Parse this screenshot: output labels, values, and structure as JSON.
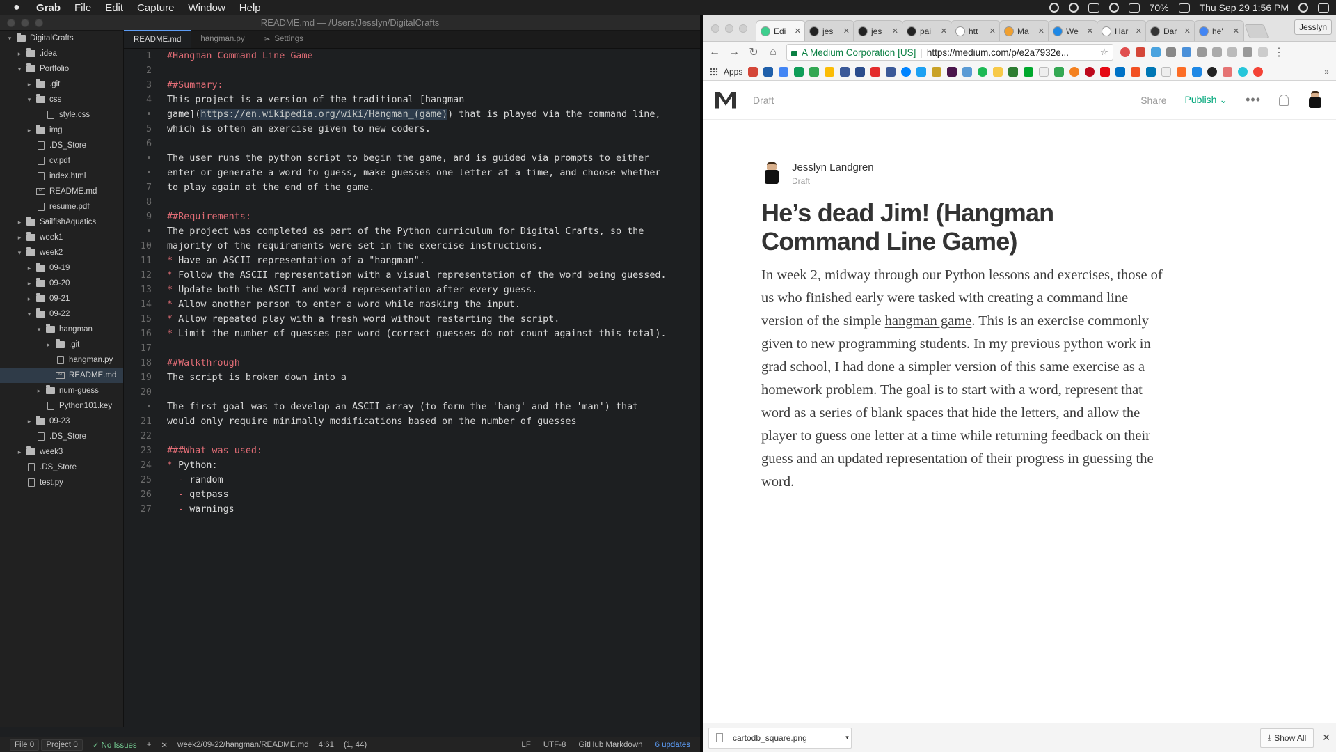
{
  "menubar": {
    "app": "Grab",
    "items": [
      "File",
      "Edit",
      "Capture",
      "Window",
      "Help"
    ],
    "battery": "70%",
    "datetime": "Thu Sep 29  1:56 PM"
  },
  "atom": {
    "window_title": "README.md — /Users/Jesslyn/DigitalCrafts",
    "tabs": [
      "README.md",
      "hangman.py",
      "Settings"
    ],
    "tree": [
      {
        "label": "DigitalCrafts",
        "kind": "folder",
        "indent": 0,
        "arrow": "▾"
      },
      {
        "label": ".idea",
        "kind": "folder",
        "indent": 1,
        "arrow": "▸"
      },
      {
        "label": "Portfolio",
        "kind": "folder",
        "indent": 1,
        "arrow": "▾"
      },
      {
        "label": ".git",
        "kind": "folder",
        "indent": 2,
        "arrow": "▸"
      },
      {
        "label": "css",
        "kind": "folder",
        "indent": 2,
        "arrow": "▾"
      },
      {
        "label": "style.css",
        "kind": "file",
        "indent": 3,
        "arrow": ""
      },
      {
        "label": "img",
        "kind": "folder",
        "indent": 2,
        "arrow": "▸"
      },
      {
        "label": ".DS_Store",
        "kind": "file",
        "indent": 2,
        "arrow": ""
      },
      {
        "label": "cv.pdf",
        "kind": "file",
        "indent": 2,
        "arrow": ""
      },
      {
        "label": "index.html",
        "kind": "file",
        "indent": 2,
        "arrow": ""
      },
      {
        "label": "README.md",
        "kind": "md",
        "indent": 2,
        "arrow": ""
      },
      {
        "label": "resume.pdf",
        "kind": "file",
        "indent": 2,
        "arrow": ""
      },
      {
        "label": "SailfishAquatics",
        "kind": "folder",
        "indent": 1,
        "arrow": "▸"
      },
      {
        "label": "week1",
        "kind": "folder",
        "indent": 1,
        "arrow": "▸"
      },
      {
        "label": "week2",
        "kind": "folder",
        "indent": 1,
        "arrow": "▾"
      },
      {
        "label": "09-19",
        "kind": "folder",
        "indent": 2,
        "arrow": "▸"
      },
      {
        "label": "09-20",
        "kind": "folder",
        "indent": 2,
        "arrow": "▸"
      },
      {
        "label": "09-21",
        "kind": "folder",
        "indent": 2,
        "arrow": "▸"
      },
      {
        "label": "09-22",
        "kind": "folder",
        "indent": 2,
        "arrow": "▾"
      },
      {
        "label": "hangman",
        "kind": "folder",
        "indent": 3,
        "arrow": "▾"
      },
      {
        "label": ".git",
        "kind": "folder",
        "indent": 4,
        "arrow": "▸"
      },
      {
        "label": "hangman.py",
        "kind": "file",
        "indent": 4,
        "arrow": ""
      },
      {
        "label": "README.md",
        "kind": "md",
        "indent": 4,
        "arrow": "",
        "selected": true
      },
      {
        "label": "num-guess",
        "kind": "folder",
        "indent": 3,
        "arrow": "▸"
      },
      {
        "label": "Python101.key",
        "kind": "file",
        "indent": 3,
        "arrow": ""
      },
      {
        "label": "09-23",
        "kind": "folder",
        "indent": 2,
        "arrow": "▸"
      },
      {
        "label": ".DS_Store",
        "kind": "file",
        "indent": 2,
        "arrow": ""
      },
      {
        "label": "week3",
        "kind": "folder",
        "indent": 1,
        "arrow": "▸"
      },
      {
        "label": ".DS_Store",
        "kind": "file",
        "indent": 1,
        "arrow": ""
      },
      {
        "label": "test.py",
        "kind": "file",
        "indent": 1,
        "arrow": ""
      }
    ],
    "gutter": [
      "1",
      "2",
      "3",
      "4",
      "•",
      "5",
      "6",
      "•",
      "•",
      "7",
      "8",
      "9",
      "•",
      "10",
      "11",
      "12",
      "13",
      "14",
      "15",
      "16",
      "17",
      "18",
      "19",
      "20",
      "•",
      "21",
      "22",
      "23",
      "24",
      "25",
      "26",
      "27"
    ],
    "code": [
      {
        "t": "#Hangman Command Line Game",
        "s": "heading"
      },
      {
        "t": "",
        "s": ""
      },
      {
        "t": "##Summary:",
        "s": "heading"
      },
      {
        "t": "This project is a version of the traditional [hangman",
        "s": ""
      },
      {
        "t": "game](https://en.wikipedia.org/wiki/Hangman_(game)) that is played via the command line,",
        "s": "url"
      },
      {
        "t": "which is often an exercise given to new coders.",
        "s": ""
      },
      {
        "t": "",
        "s": ""
      },
      {
        "t": "The user runs the python script to begin the game, and is guided via prompts to either",
        "s": ""
      },
      {
        "t": "enter or generate a word to guess, make guesses one letter at a time, and choose whether",
        "s": ""
      },
      {
        "t": "to play again at the end of the game.",
        "s": ""
      },
      {
        "t": "",
        "s": ""
      },
      {
        "t": "##Requirements:",
        "s": "heading"
      },
      {
        "t": "The project was completed as part of the Python curriculum for Digital Crafts, so the",
        "s": ""
      },
      {
        "t": "majority of the requirements were set in the exercise instructions.",
        "s": ""
      },
      {
        "t": "* Have an ASCII representation of a \"hangman\".",
        "s": "bullet"
      },
      {
        "t": "* Follow the ASCII representation with a visual representation of the word being guessed.",
        "s": "bullet"
      },
      {
        "t": "* Update both the ASCII and word representation after every guess.",
        "s": "bullet"
      },
      {
        "t": "* Allow another person to enter a word while masking the input.",
        "s": "bullet"
      },
      {
        "t": "* Allow repeated play with a fresh word without restarting the script.",
        "s": "bullet"
      },
      {
        "t": "* Limit the number of guesses per word (correct guesses do not count against this total).",
        "s": "bullet"
      },
      {
        "t": "",
        "s": ""
      },
      {
        "t": "##Walkthrough",
        "s": "heading"
      },
      {
        "t": "The script is broken down into a",
        "s": ""
      },
      {
        "t": "",
        "s": ""
      },
      {
        "t": "The first goal was to develop an ASCII array (to form the 'hang' and the 'man') that",
        "s": ""
      },
      {
        "t": "would only require minimally modifications based on the number of guesses",
        "s": ""
      },
      {
        "t": "",
        "s": ""
      },
      {
        "t": "###What was used:",
        "s": "heading"
      },
      {
        "t": "* Python:",
        "s": "bullet"
      },
      {
        "t": "  - random",
        "s": "dash"
      },
      {
        "t": "  - getpass",
        "s": "dash"
      },
      {
        "t": "  - warnings",
        "s": "dash"
      },
      {
        "t": "",
        "s": ""
      }
    ],
    "status": {
      "file": "File 0",
      "project": "Project 0",
      "issues": "✓ No Issues",
      "plus": "+",
      "x": "✕",
      "path": "week2/09-22/hangman/README.md",
      "cursor": "4:61",
      "selection": "(1, 44)",
      "eol": "LF",
      "encoding": "UTF-8",
      "grammar": "GitHub Markdown",
      "updates": "6 updates"
    }
  },
  "chrome": {
    "tabs": [
      "Edi",
      "jes",
      "jes",
      "pai",
      "htt",
      "Ma",
      "We",
      "Har",
      "Dar",
      "he'"
    ],
    "profile": "Jesslyn",
    "secure_label": "A Medium Corporation [US]",
    "url": "https://medium.com/p/e2a7932e...",
    "apps_label": "Apps",
    "accent": "#03a87c"
  },
  "medium": {
    "draft": "Draft",
    "share": "Share",
    "publish": "Publish",
    "author": "Jesslyn Landgren",
    "author_status": "Draft",
    "title": "He’s dead Jim! (Hangman Command Line Game)",
    "body_before": "In week 2, midway through our Python lessons and exercises, those of us who finished early were tasked with creating a command line version of the simple ",
    "body_link": "hangman game",
    "body_after": ". This is an exercise commonly given to new programming students. In my previous python work in grad school, I had done a simpler version of this same exercise as a homework problem. The goal is to start with a word, represent that word as a series of blank spaces that hide the letters, and allow the player to guess one letter at a time while returning feedback on their guess and an updated representation of their progress in guessing the word."
  },
  "downloads": {
    "file": "cartodb_square.png",
    "show_all": "Show All"
  }
}
